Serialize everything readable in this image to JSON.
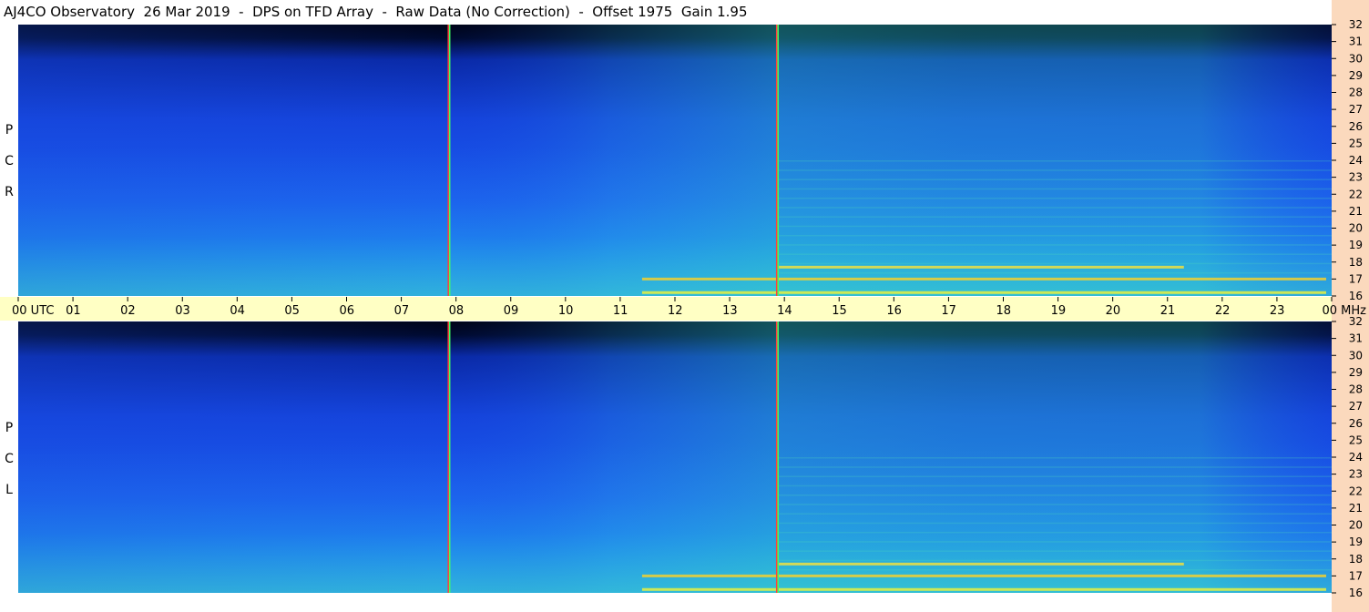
{
  "title": "AJ4CO Observatory  26 Mar 2019  -  DPS on TFD Array  -  Raw Data (No Correction)  -  Offset 1975  Gain 1.95",
  "colors": {
    "background": "#ffffff",
    "time_band": "#ffffc4",
    "right_strip": "#fbd9bd",
    "spectrogram_low": "#001a5c",
    "spectrogram_mid": "#1a5cf0",
    "spectrogram_high": "#2fd6c0",
    "interference": "#f0e040",
    "marker_line": "#ff4040"
  },
  "chart_data": {
    "type": "heatmap",
    "title": "AJ4CO Observatory  26 Mar 2019  -  DPS on TFD Array  -  Raw Data (No Correction)  -  Offset 1975  Gain 1.95",
    "x_axis": {
      "label": "UTC",
      "unit": "hour",
      "range": [
        0,
        24
      ],
      "tick_labels": [
        "00 UTC",
        "01",
        "02",
        "03",
        "04",
        "05",
        "06",
        "07",
        "08",
        "09",
        "10",
        "11",
        "12",
        "13",
        "14",
        "15",
        "16",
        "17",
        "18",
        "19",
        "20",
        "21",
        "22",
        "23",
        "00 MHz"
      ]
    },
    "y_axis": {
      "label": "MHz",
      "unit": "MHz",
      "range": [
        16,
        32
      ],
      "tick_labels": [
        "32",
        "31",
        "30",
        "29",
        "28",
        "27",
        "26",
        "25",
        "24",
        "23",
        "22",
        "21",
        "20",
        "19",
        "18",
        "17",
        "16"
      ]
    },
    "panels": [
      {
        "name": "R C P",
        "letters": [
          "P",
          "C",
          "R"
        ],
        "marker_lines_utc": [
          7.88,
          13.88
        ],
        "interference_bands_mhz": [
          17.7,
          17.0,
          16.2
        ]
      },
      {
        "name": "L C P",
        "letters": [
          "P",
          "C",
          "L"
        ],
        "marker_lines_utc": [
          7.88,
          13.88
        ],
        "interference_bands_mhz": [
          17.7,
          17.0,
          16.2
        ]
      }
    ],
    "grid": false,
    "legend": "none"
  }
}
